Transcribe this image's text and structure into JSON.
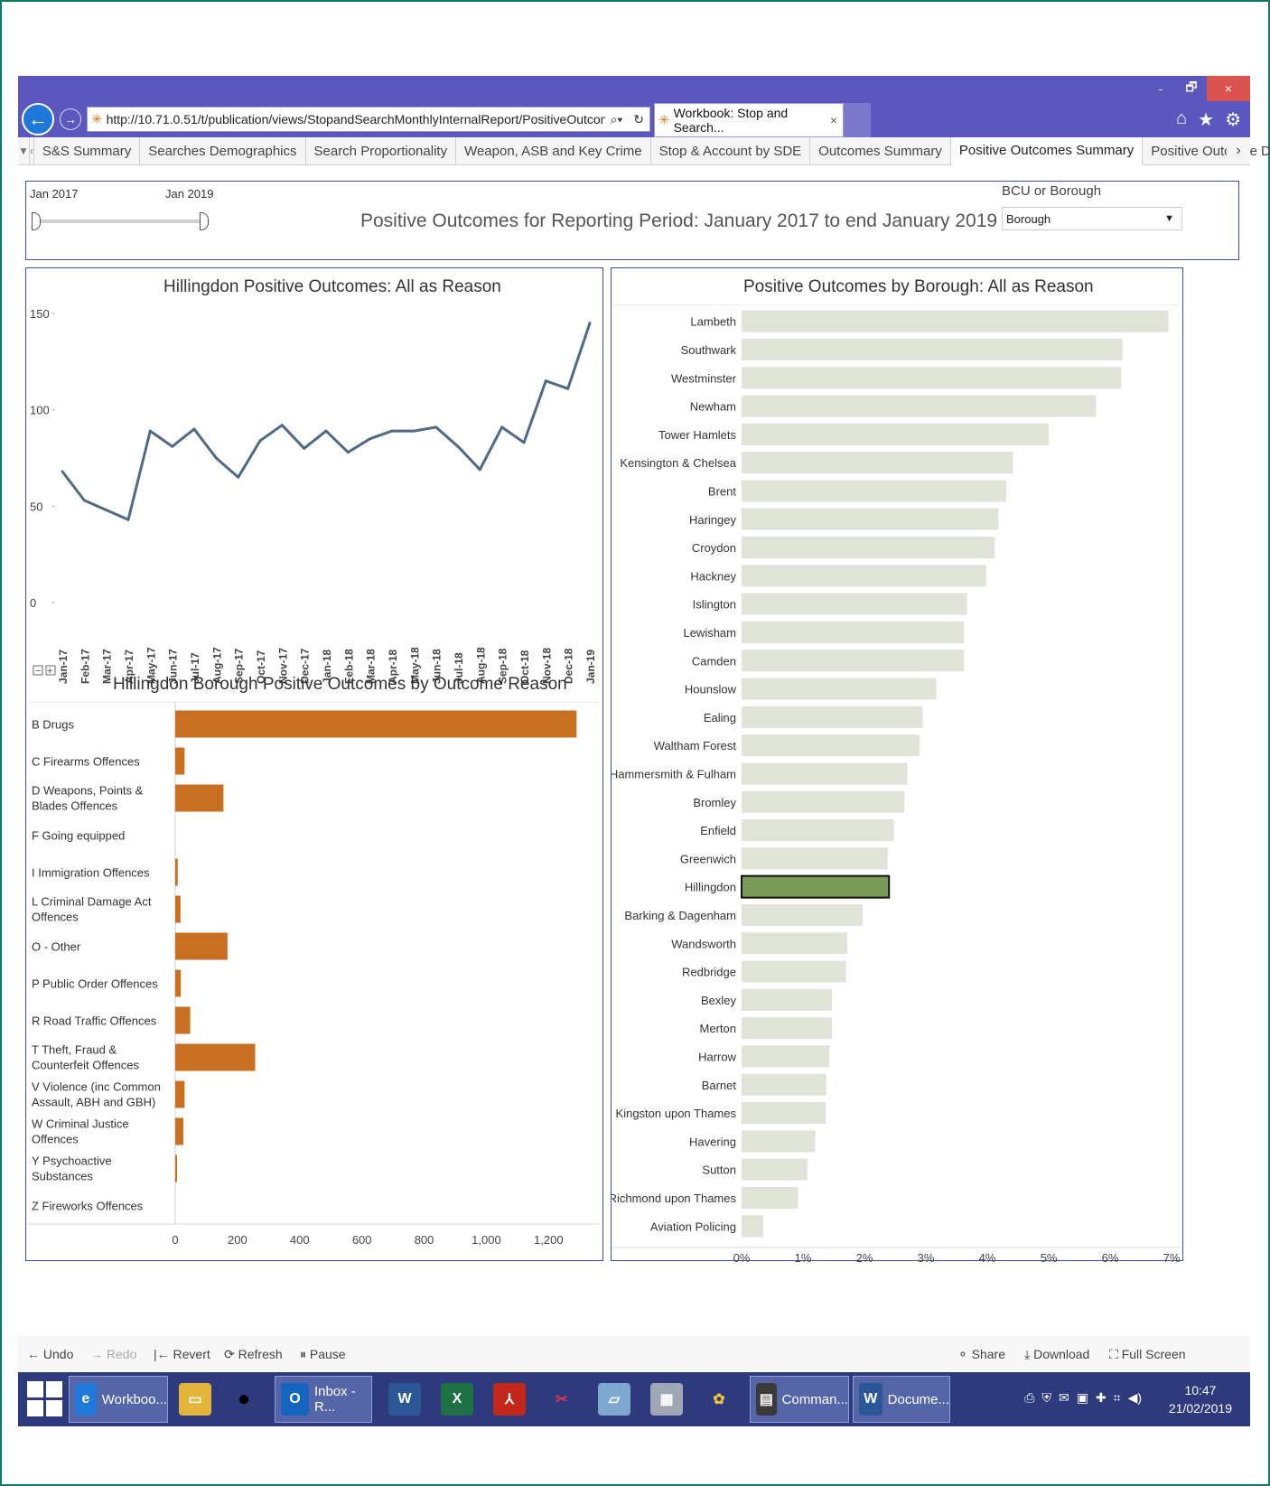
{
  "browser": {
    "url": "http://10.71.0.51/t/publication/views/StopandSearchMonthlyInternalReport/PositiveOutcon",
    "tab_title": "Workbook: Stop and Search...",
    "window_controls": [
      "-",
      "🗗",
      "×"
    ]
  },
  "sheet_tabs": [
    {
      "label": "S&S Summary",
      "active": false
    },
    {
      "label": "Searches Demographics",
      "active": false
    },
    {
      "label": "Search Proportionality",
      "active": false
    },
    {
      "label": "Weapon, ASB and Key Crime",
      "active": false
    },
    {
      "label": "Stop & Account by SDE",
      "active": false
    },
    {
      "label": "Outcomes Summary",
      "active": false
    },
    {
      "label": "Positive Outcomes Summary",
      "active": true
    },
    {
      "label": "Positive Outcome D",
      "active": false
    }
  ],
  "filters": {
    "slider_start": "Jan 2017",
    "slider_end": "Jan 2019",
    "title": "Positive Outcomes for Reporting Period: January 2017 to end January 2019",
    "bcu_label": "BCU or Borough",
    "bcu_value": "Borough"
  },
  "chart_data": [
    {
      "type": "line",
      "title": "Hillingdon Positive Outcomes: All as Reason",
      "x": [
        "Jan-17",
        "Feb-17",
        "Mar-17",
        "Apr-17",
        "May-17",
        "Jun-17",
        "Jul-17",
        "Aug-17",
        "Sep-17",
        "Oct-17",
        "Nov-17",
        "Dec-17",
        "Jan-18",
        "Feb-18",
        "Mar-18",
        "Apr-18",
        "May-18",
        "Jun-18",
        "Jul-18",
        "Aug-18",
        "Sep-18",
        "Oct-18",
        "Nov-18",
        "Dec-18",
        "Jan-19"
      ],
      "values": [
        68,
        53,
        48,
        43,
        89,
        81,
        90,
        75,
        65,
        84,
        92,
        80,
        89,
        78,
        85,
        89,
        89,
        91,
        81,
        69,
        91,
        83,
        115,
        111,
        145
      ],
      "yticks": [
        "150",
        "100",
        "50",
        "0"
      ],
      "ylim": [
        0,
        150
      ],
      "color": "#4e6a85"
    },
    {
      "type": "bar",
      "title": "Hillingdon Borough Positive Outcomes by Outcome Reason",
      "categories": [
        "B Drugs",
        "C Firearms Offences",
        "D Weapons, Points & Blades Offences",
        "F Going equipped",
        "I Immigration Offences",
        "L Criminal Damage Act Offences",
        "O - Other",
        "P Public Order Offences",
        "R Road Traffic Offences",
        "T Theft, Fraud & Counterfeit Offences",
        "V Violence (inc Common Assault, ABH and GBH)",
        "W Criminal Justice Offences",
        "Y Psychoactive Substances",
        "Z Fireworks Offences"
      ],
      "values": [
        1290,
        30,
        155,
        0,
        8,
        17,
        168,
        18,
        48,
        257,
        30,
        26,
        4,
        0
      ],
      "xticks": [
        "0",
        "200",
        "400",
        "600",
        "800",
        "1,000",
        "1,200"
      ],
      "xlim": [
        0,
        1350
      ],
      "color": "#c86f22"
    },
    {
      "type": "bar",
      "title": "Positive Outcomes by Borough: All as Reason",
      "categories": [
        "Lambeth",
        "Southwark",
        "Westminster",
        "Newham",
        "Tower Hamlets",
        "Kensington & Chelsea",
        "Brent",
        "Haringey",
        "Croydon",
        "Hackney",
        "Islington",
        "Lewisham",
        "Camden",
        "Hounslow",
        "Ealing",
        "Waltham Forest",
        "Hammersmith & Fulham",
        "Bromley",
        "Enfield",
        "Greenwich",
        "Hillingdon",
        "Barking & Dagenham",
        "Wandsworth",
        "Redbridge",
        "Bexley",
        "Merton",
        "Harrow",
        "Barnet",
        "Kingston upon Thames",
        "Havering",
        "Sutton",
        "Richmond upon Thames",
        "Aviation Policing"
      ],
      "values": [
        6.95,
        6.2,
        6.18,
        5.77,
        5.0,
        4.42,
        4.31,
        4.18,
        4.12,
        3.98,
        3.67,
        3.62,
        3.62,
        3.17,
        2.95,
        2.9,
        2.7,
        2.65,
        2.48,
        2.38,
        2.4,
        1.97,
        1.72,
        1.7,
        1.47,
        1.47,
        1.43,
        1.38,
        1.37,
        1.2,
        1.07,
        0.92,
        0.35
      ],
      "xticks": [
        "0%",
        "1%",
        "2%",
        "3%",
        "4%",
        "5%",
        "6%",
        "7%"
      ],
      "xlim": [
        0,
        7
      ],
      "highlight": "Hillingdon",
      "color": "#dfe3d8",
      "highlight_color": "#7a9a57"
    }
  ],
  "toolbar": {
    "undo": "Undo",
    "redo": "Redo",
    "revert": "Revert",
    "refresh": "Refresh",
    "pause": "Pause",
    "share": "Share",
    "download": "Download",
    "fullscreen": "Full Screen"
  },
  "taskbar": {
    "apps": [
      {
        "label": "Workboo...",
        "icon": "e"
      },
      {
        "label": "Inbox - R...",
        "icon": "O"
      },
      {
        "label": "Comman...",
        "icon": "▤"
      },
      {
        "label": "Docume...",
        "icon": "W"
      }
    ],
    "time": "10:47",
    "date": "21/02/2019"
  }
}
